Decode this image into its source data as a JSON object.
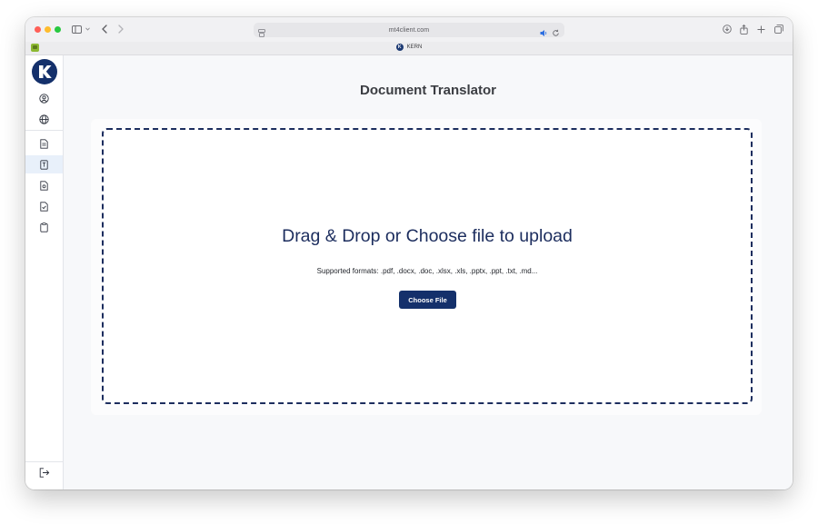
{
  "browser": {
    "address": "mt4client.com",
    "tab_title": "KERN",
    "tab_logo_letter": "K"
  },
  "app": {
    "logo_letter": "K",
    "page_title": "Document Translator",
    "upload": {
      "heading": "Drag & Drop or Choose file to upload",
      "formats": "Supported formats: .pdf, .docx, .doc, .xlsx, .xls, .pptx, .ppt, .txt, .md...",
      "button_label": "Choose File"
    }
  },
  "colors": {
    "brand_navy": "#14306b",
    "dropzone_border": "#1c2d5e",
    "active_nav_bg": "#e8f0fa"
  },
  "sidebar_icons": [
    "user-circle-icon",
    "globe-icon",
    "document-icon",
    "document-text-icon",
    "document-image-icon",
    "document-check-icon",
    "clipboard-icon",
    "logout-icon"
  ]
}
